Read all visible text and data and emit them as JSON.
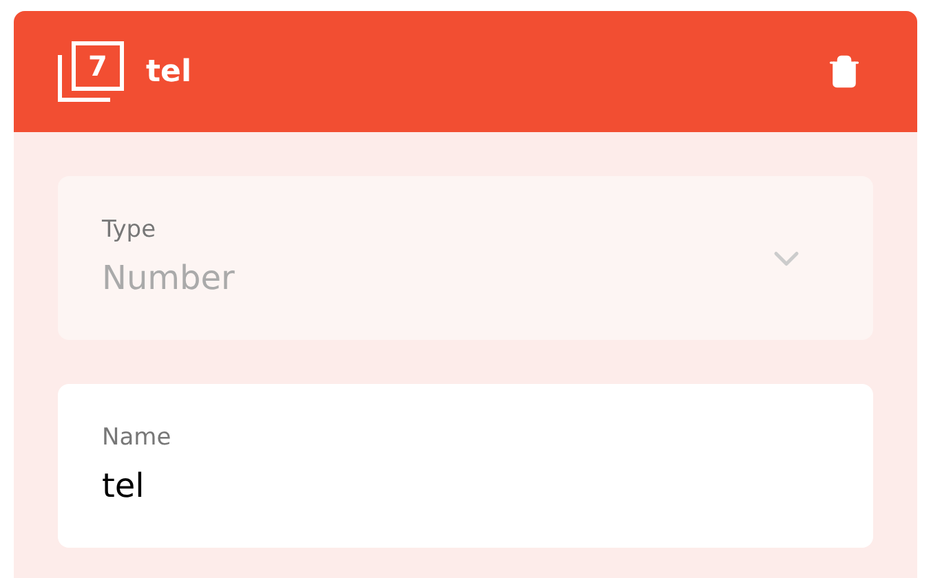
{
  "header": {
    "badge": "7",
    "title": "tel"
  },
  "fields": [
    {
      "kind": "select",
      "label": "Type",
      "value": "Number",
      "disabled": true
    },
    {
      "kind": "text",
      "label": "Name",
      "value": "tel",
      "disabled": false
    }
  ]
}
